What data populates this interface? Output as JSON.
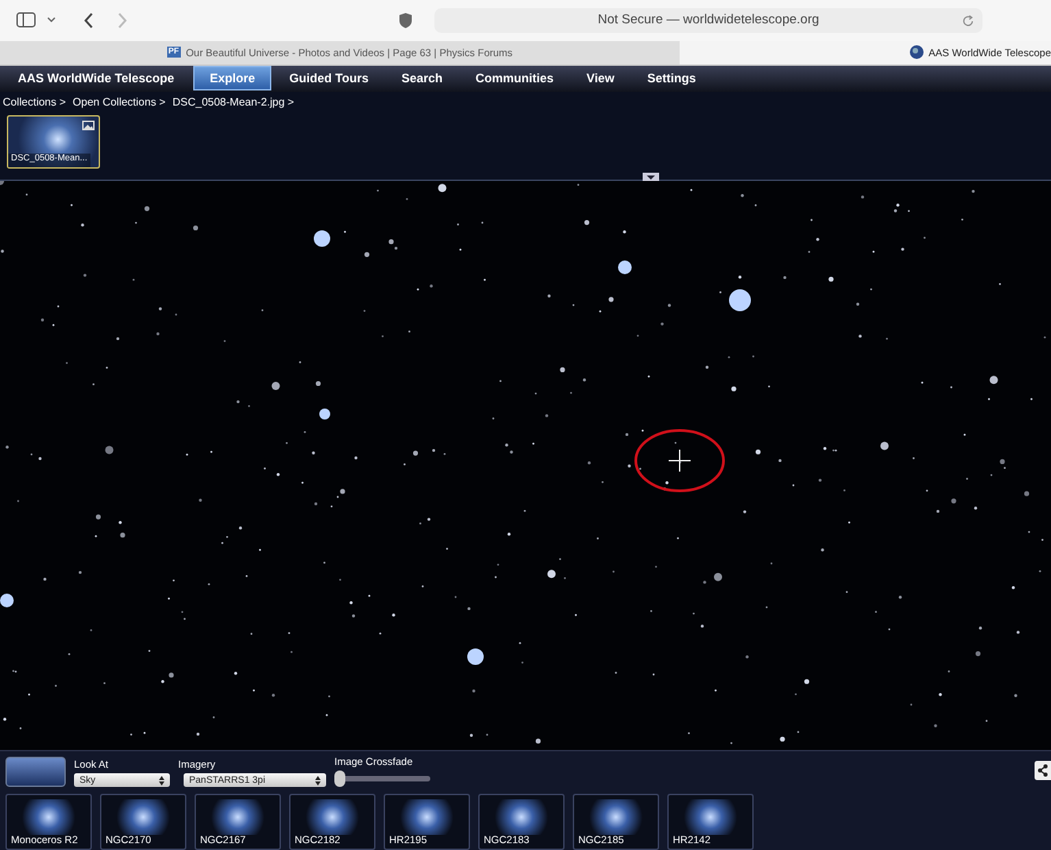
{
  "browser": {
    "address": "Not Secure — worldwidetelescope.org",
    "tabs": [
      {
        "favicon": "PF",
        "title": "Our Beautiful Universe - Photos and Videos | Page 63 | Physics Forums",
        "selected": false
      },
      {
        "title": "AAS WorldWide Telescope",
        "selected": true
      }
    ]
  },
  "app": {
    "title": "AAS WorldWide Telescope",
    "menu": [
      {
        "label": "Explore",
        "selected": true
      },
      {
        "label": "Guided Tours",
        "selected": false
      },
      {
        "label": "Search",
        "selected": false
      },
      {
        "label": "Communities",
        "selected": false
      },
      {
        "label": "View",
        "selected": false
      },
      {
        "label": "Settings",
        "selected": false
      }
    ]
  },
  "breadcrumb": [
    "Collections >",
    "Open Collections >",
    "DSC_0508-Mean-2.jpg >"
  ],
  "collection": [
    {
      "label": "DSC_0508-Mean...",
      "selected": true
    }
  ],
  "controls": {
    "look_at": {
      "label": "Look At",
      "value": "Sky"
    },
    "imagery": {
      "label": "Imagery",
      "value": "PanSTARRS1 3pi"
    },
    "crossfade": {
      "label": "Image Crossfade",
      "level": 0
    }
  },
  "thumbnails": [
    {
      "label": "Monoceros R2"
    },
    {
      "label": "NGC2170"
    },
    {
      "label": "NGC2167"
    },
    {
      "label": "NGC2182"
    },
    {
      "label": "HR2195"
    },
    {
      "label": "NGC2183"
    },
    {
      "label": "NGC2185"
    },
    {
      "label": "HR2142"
    }
  ]
}
